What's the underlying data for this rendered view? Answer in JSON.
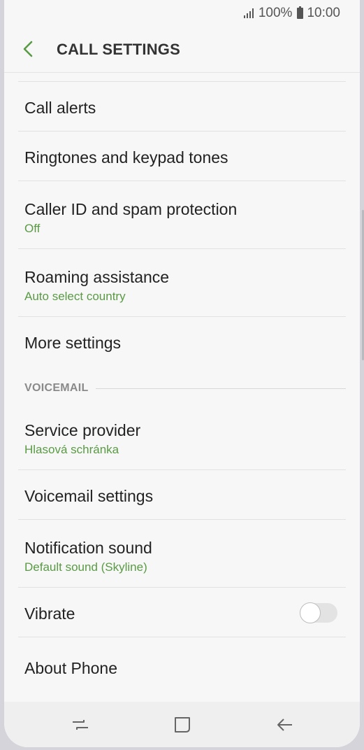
{
  "status_bar": {
    "battery": "100%",
    "time": "10:00"
  },
  "header": {
    "title": "CALL SETTINGS"
  },
  "items_top": [
    {
      "title": "Call alerts"
    },
    {
      "title": "Ringtones and keypad tones"
    },
    {
      "title": "Caller ID and spam protection",
      "subtitle": "Off"
    },
    {
      "title": "Roaming assistance",
      "subtitle": "Auto select country"
    },
    {
      "title": "More settings"
    }
  ],
  "voicemail_section": {
    "label": "VOICEMAIL",
    "items": [
      {
        "title": "Service provider",
        "subtitle": "Hlasová schránka"
      },
      {
        "title": "Voicemail settings"
      },
      {
        "title": "Notification sound",
        "subtitle": "Default sound (Skyline)"
      },
      {
        "title": "Vibrate",
        "toggle": false
      },
      {
        "title": "About Phone"
      }
    ]
  },
  "colors": {
    "accent": "#5a9a45",
    "background": "#f7f7f7"
  },
  "icons": {
    "back": "back-arrow-icon",
    "recents": "recents-icon",
    "home": "home-icon",
    "nav_back": "nav-back-icon"
  }
}
